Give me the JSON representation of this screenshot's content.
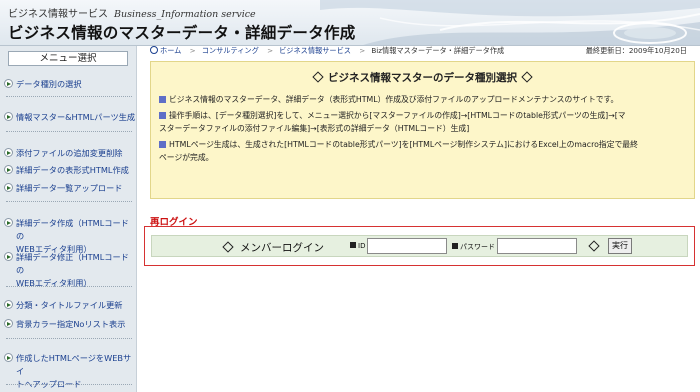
{
  "header": {
    "service_jp": "ビジネス情報サービス",
    "service_en": "Business_Information service",
    "title": "ビジネス情報のマスターデータ・詳細データ作成"
  },
  "sidebar": {
    "heading": "メニュー選択",
    "items": [
      {
        "label": "データ種別の選択"
      },
      {
        "label": "情報マスター&HTMLパーツ生成"
      },
      {
        "label": "添付ファイルの追加変更削除"
      },
      {
        "label": "詳細データの表形式HTML作成"
      },
      {
        "label": "詳細データ一覧アップロード"
      },
      {
        "line1": "詳細データ作成（HTMLコードの",
        "line2": "WEBエディタ利用）"
      },
      {
        "line1": "詳細データ修正（HTMLコードの",
        "line2": "WEBエディタ利用）"
      },
      {
        "label": "分類・タイトルファイル更新"
      },
      {
        "label": "背景カラー指定Noリスト表示"
      },
      {
        "line1": "作成したHTMLページをWEBサイ",
        "line2": "トへアップロード"
      }
    ]
  },
  "breadcrumb": {
    "items": [
      "ホーム",
      "コンサルティング",
      "ビジネス情報サービス",
      "Biz情報マスターデータ・詳細データ作成"
    ],
    "updated": "最終更新日：2009年10月20日"
  },
  "info": {
    "title": "ビジネス情報マスターのデータ種別選択",
    "p1": "ビジネス情報のマスターデータ、詳細データ（表形式HTML）作成及び添付ファイルのアップロードメンテナンスのサイトです。",
    "p2_line1": "操作手順は、[データ種別選択]をして、メニュー選択から[マスターファイルの作成]→[HTMLコードのtable形式パーツの生成]→[マ",
    "p2_line2": "スターデータファイルの添付ファイル編集]→[表形式の詳細データ（HTMLコード）生成]",
    "p3_line1": "HTMLページ生成は、生成された[HTMLコードのtable形式パーツ]を[HTMLページ制作システム]におけるExcel上のmacro指定で最終",
    "p3_line2": "ページが完成。"
  },
  "login": {
    "relogin": "再ログイン",
    "label": "メンバーログイン",
    "id_label": "ID",
    "id_value": "",
    "password_label": "パスワード",
    "password_value": "",
    "submit": "実行"
  },
  "colors": {
    "relogin_red": "#cc1111",
    "info_bg": "#fdf6c9",
    "sidebar_bg": "#e3e9ee",
    "link_blue": "#1a3f8f",
    "login_bar": "#e6f0e0"
  }
}
